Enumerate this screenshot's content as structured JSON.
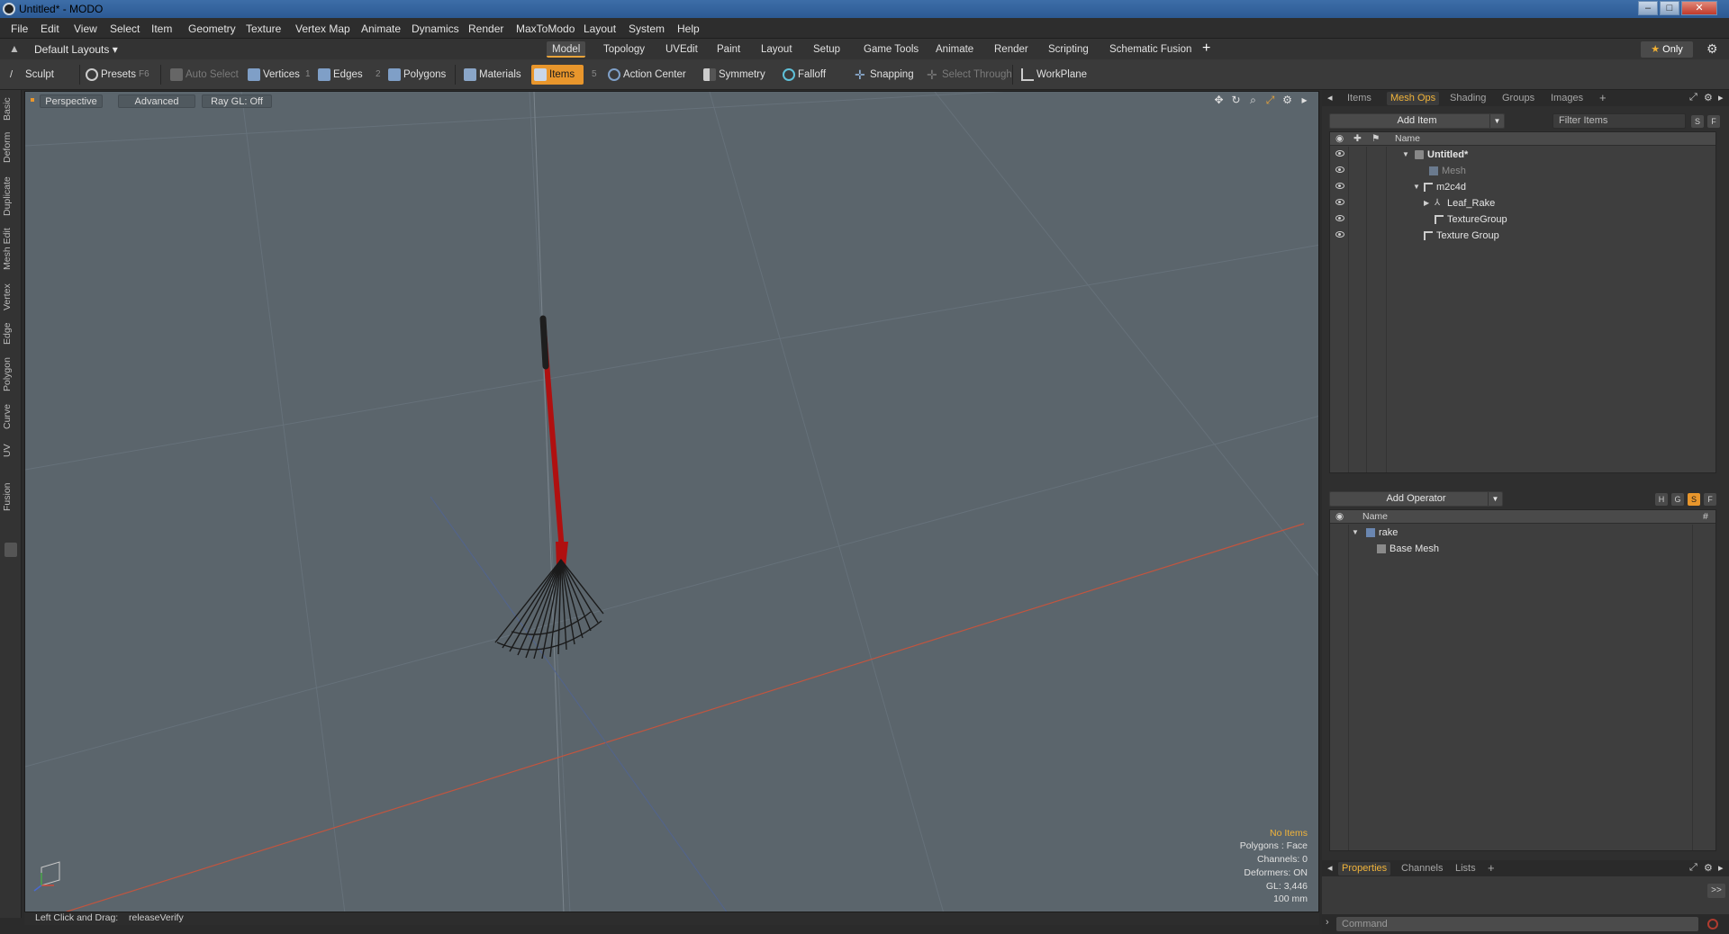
{
  "window": {
    "title": "Untitled* - MODO"
  },
  "menu": [
    "File",
    "Edit",
    "View",
    "Select",
    "Item",
    "Geometry",
    "Texture",
    "Vertex Map",
    "Animate",
    "Dynamics",
    "Render",
    "MaxToModo",
    "Layout",
    "System",
    "Help"
  ],
  "layout_bar": {
    "layout_dropdown": "Default Layouts",
    "tabs": [
      "Model",
      "Topology",
      "UVEdit",
      "Paint",
      "Layout",
      "Setup",
      "Game Tools",
      "Animate",
      "Render",
      "Scripting",
      "Schematic Fusion"
    ],
    "active_tab": "Model",
    "only_label": "Only"
  },
  "toolbar": {
    "sculpt": "Sculpt",
    "presets": "Presets",
    "presets_key": "F6",
    "auto_select": "Auto Select",
    "vertices": "Vertices",
    "vertices_key": "1",
    "edges": "Edges",
    "edges_key": "2",
    "polygons": "Polygons",
    "materials": "Materials",
    "items": "Items",
    "items_key": "5",
    "action_center": "Action Center",
    "symmetry": "Symmetry",
    "falloff": "Falloff",
    "snapping": "Snapping",
    "select_through": "Select Through",
    "workplane": "WorkPlane"
  },
  "left_tabs": [
    "Basic",
    "Deform",
    "Duplicate",
    "Mesh Edit",
    "Vertex",
    "Edge",
    "Polygon",
    "Curve",
    "UV",
    "Fusion"
  ],
  "viewport": {
    "view_mode": "Perspective",
    "shading": "Advanced",
    "raygl": "Ray GL: Off",
    "stats": {
      "items": "No Items",
      "polygons": "Polygons : Face",
      "channels": "Channels: 0",
      "deformers": "Deformers: ON",
      "gl": "GL: 3,446",
      "scale": "100 mm"
    }
  },
  "statusline": {
    "label": "Left Click and Drag:",
    "value": "releaseVerify"
  },
  "item_panel": {
    "tabs": [
      "Items",
      "Mesh Ops",
      "Shading",
      "Groups",
      "Images"
    ],
    "active_tab": "Mesh Ops",
    "add_item": "Add Item",
    "filter_placeholder": "Filter Items",
    "column_name": "Name",
    "tree": [
      {
        "label": "Untitled*",
        "style": "bold"
      },
      {
        "label": "Mesh",
        "style": "grey"
      },
      {
        "label": "m2c4d",
        "style": "normal"
      },
      {
        "label": "Leaf_Rake",
        "style": "normal"
      },
      {
        "label": "TextureGroup",
        "style": "normal"
      },
      {
        "label": "Texture Group",
        "style": "normal"
      }
    ]
  },
  "operator_panel": {
    "add_operator": "Add Operator",
    "buttons": [
      "H",
      "G",
      "S",
      "F"
    ],
    "column_name": "Name",
    "column_hash": "#",
    "tree": [
      {
        "label": "rake"
      },
      {
        "label": "Base Mesh"
      }
    ]
  },
  "bottom_panel": {
    "tabs": [
      "Properties",
      "Channels",
      "Lists"
    ],
    "active_tab": "Properties",
    "more": ">>",
    "command_placeholder": "Command"
  },
  "colors": {
    "accent": "#e8962c",
    "viewport_bg": "#5b656c",
    "rake_handle": "#b01010",
    "active_tab_text": "#f0b33a"
  }
}
